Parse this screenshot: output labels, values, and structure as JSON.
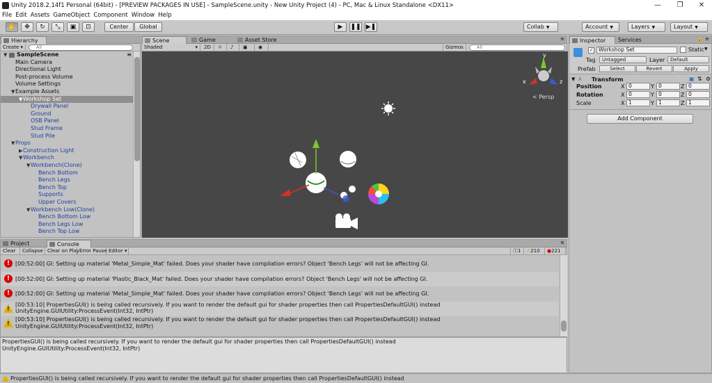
{
  "window": {
    "title": "Unity 2018.2.14f1 Personal (64bit) - [PREVIEW PACKAGES IN USE] - SampleScene.unity - New Unity Project (4) - PC, Mac & Linux Standalone <DX11>",
    "min": "—",
    "max": "❐",
    "close": "✕"
  },
  "menu": [
    "File",
    "Edit",
    "Assets",
    "GameObject",
    "Component",
    "Window",
    "Help"
  ],
  "toolbar": {
    "center": "Center",
    "global": "Global",
    "collab": "Collab",
    "account": "Account",
    "layers": "Layers",
    "layout": "Layout",
    "play": "▶",
    "pause": "❚❚",
    "step": "▶❚"
  },
  "hierarchy": {
    "tab": "Hierarchy",
    "create": "Create",
    "search_placeholder": "All",
    "scene": "SampleScene",
    "items": [
      {
        "label": "Main Camera",
        "indent": 0,
        "arrow": "",
        "color": "black",
        "selected": false
      },
      {
        "label": "Directional Light",
        "indent": 0,
        "arrow": "",
        "color": "black",
        "selected": false
      },
      {
        "label": "Post-process Volume",
        "indent": 0,
        "arrow": "",
        "color": "black",
        "selected": false
      },
      {
        "label": "Volume Settings",
        "indent": 0,
        "arrow": "",
        "color": "black",
        "selected": false
      },
      {
        "label": "Example Assets",
        "indent": 0,
        "arrow": "▼",
        "color": "black",
        "selected": false
      },
      {
        "label": "Workshop Set",
        "indent": 1,
        "arrow": "▼",
        "color": "selected",
        "selected": true
      },
      {
        "label": "Drywall Panel",
        "indent": 2,
        "arrow": "",
        "color": "blue",
        "selected": false
      },
      {
        "label": "Ground",
        "indent": 2,
        "arrow": "",
        "color": "blue",
        "selected": false
      },
      {
        "label": "OSB Panel",
        "indent": 2,
        "arrow": "",
        "color": "blue",
        "selected": false
      },
      {
        "label": "Stud Frame",
        "indent": 2,
        "arrow": "",
        "color": "blue",
        "selected": false
      },
      {
        "label": "Stud Pile",
        "indent": 2,
        "arrow": "",
        "color": "blue",
        "selected": false
      },
      {
        "label": "Props",
        "indent": 0,
        "arrow": "▼",
        "color": "blue",
        "selected": false
      },
      {
        "label": "Construction Light",
        "indent": 1,
        "arrow": "▶",
        "color": "blue",
        "selected": false
      },
      {
        "label": "Workbench",
        "indent": 1,
        "arrow": "▼",
        "color": "blue",
        "selected": false
      },
      {
        "label": "Workbench(Clone)",
        "indent": 2,
        "arrow": "▼",
        "color": "blue",
        "selected": false
      },
      {
        "label": "Bench Bottom",
        "indent": 3,
        "arrow": "",
        "color": "blue",
        "selected": false
      },
      {
        "label": "Bench Legs",
        "indent": 3,
        "arrow": "",
        "color": "blue",
        "selected": false
      },
      {
        "label": "Bench Top",
        "indent": 3,
        "arrow": "",
        "color": "blue",
        "selected": false
      },
      {
        "label": "Supports",
        "indent": 3,
        "arrow": "",
        "color": "blue",
        "selected": false
      },
      {
        "label": "Upper Covers",
        "indent": 3,
        "arrow": "",
        "color": "blue",
        "selected": false
      },
      {
        "label": "Workbench Low(Clone)",
        "indent": 2,
        "arrow": "▼",
        "color": "blue",
        "selected": false
      },
      {
        "label": "Bench Bottom Low",
        "indent": 3,
        "arrow": "",
        "color": "blue",
        "selected": false
      },
      {
        "label": "Bench Legs Low",
        "indent": 3,
        "arrow": "",
        "color": "blue",
        "selected": false
      },
      {
        "label": "Bench Top Low",
        "indent": 3,
        "arrow": "",
        "color": "blue",
        "selected": false
      }
    ]
  },
  "scene": {
    "tabs": [
      "Scene",
      "Game",
      "Asset Store"
    ],
    "shading": "Shaded",
    "mode_2d": "2D",
    "gizmos": "Gizmos",
    "search_placeholder": "All",
    "persp": "Persp",
    "axis_y": "y",
    "axis_x": "x",
    "axis_z": "z"
  },
  "console": {
    "tabs": [
      "Project",
      "Console"
    ],
    "buttons": [
      "Clear",
      "Collapse",
      "Clear on Play",
      "Error Pause",
      "Editor"
    ],
    "counts": {
      "info": "1",
      "warn": "210",
      "error": "221"
    },
    "rows": [
      {
        "type": "error",
        "line1": "[00:52:00] GI: Setting up material 'Metal_Simple_Mat' failed. Does your shader have compilation errors? Object 'Bench Legs' will not be affecting GI.",
        "line2": ""
      },
      {
        "type": "error",
        "line1": "[00:52:00] GI: Setting up material 'Plastic_Black_Mat' failed. Does your shader have compilation errors? Object 'Bench Legs' will not be affecting GI.",
        "line2": ""
      },
      {
        "type": "error",
        "line1": "[00:52:00] GI: Setting up material 'Metal_Simple_Mat' failed. Does your shader have compilation errors? Object 'Bench Legs' will not be affecting GI.",
        "line2": ""
      },
      {
        "type": "warn",
        "line1": "[00:53:10] PropertiesGUI() is being called recursively. If you want to render the default gui for shader properties then call PropertiesDefaultGUI() instead",
        "line2": "UnityEngine.GUIUtility:ProcessEvent(Int32, IntPtr)"
      },
      {
        "type": "warn",
        "line1": "[00:53:10] PropertiesGUI() is being called recursively. If you want to render the default gui for shader properties then call PropertiesDefaultGUI() instead",
        "line2": "UnityEngine.GUIUtility:ProcessEvent(Int32, IntPtr)"
      }
    ],
    "detail_line1": "PropertiesGUI() is being called recursively. If you want to render the default gui for shader properties then call PropertiesDefaultGUI() instead",
    "detail_line2": "UnityEngine.GUIUtility:ProcessEvent(Int32, IntPtr)"
  },
  "status": "PropertiesGUI() is being called recursively. If you want to render the default gui for shader properties then call PropertiesDefaultGUI() instead",
  "inspector": {
    "tabs": [
      "Inspector",
      "Services"
    ],
    "object_name": "Workshop Set",
    "static_label": "Static",
    "tag_label": "Tag",
    "tag_value": "Untagged",
    "layer_label": "Layer",
    "layer_value": "Default",
    "prefab_label": "Prefab",
    "prefab_buttons": [
      "Select",
      "Revert",
      "Apply"
    ],
    "transform_title": "Transform",
    "position_label": "Position",
    "rotation_label": "Rotation",
    "scale_label": "Scale",
    "axis": [
      "X",
      "Y",
      "Z"
    ],
    "position": [
      "0",
      "0",
      "0"
    ],
    "rotation": [
      "0",
      "0",
      "0"
    ],
    "scale": [
      "1",
      "1",
      "1"
    ],
    "add_component": "Add Component"
  }
}
